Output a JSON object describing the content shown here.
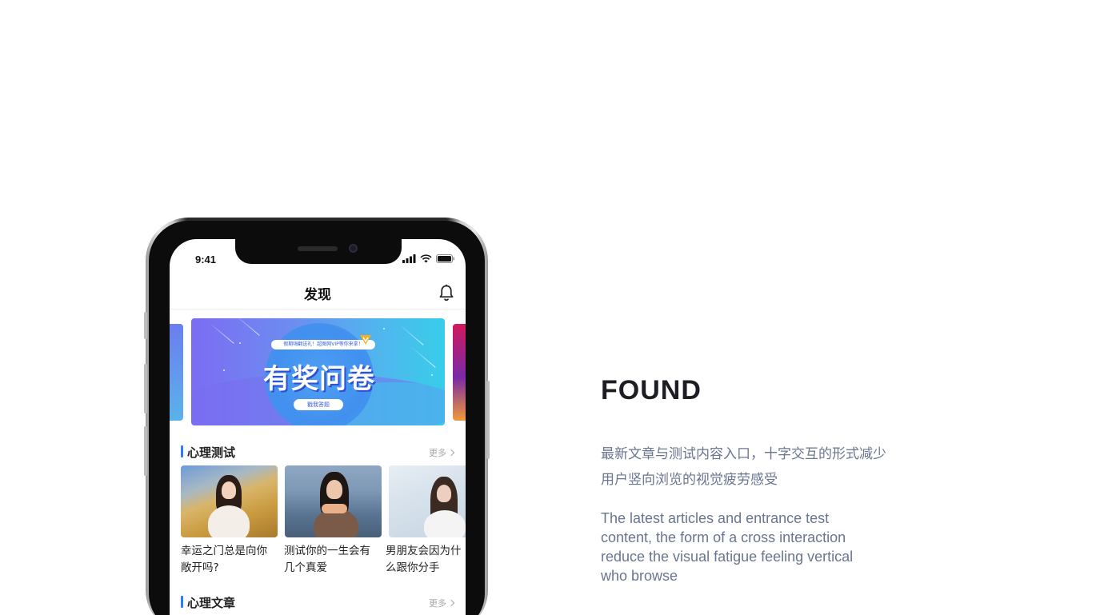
{
  "status_bar": {
    "time": "9:41"
  },
  "nav": {
    "title": "发现"
  },
  "banner": {
    "subline": "假期嗨翻送礼！超图网VIP等你来拿！",
    "title": "有奖问卷",
    "cta": "戳我答题"
  },
  "sections": {
    "tests": {
      "title": "心理测试",
      "more": "更多",
      "cards": [
        {
          "title": "幸运之门总是向你敞开吗?"
        },
        {
          "title": "测试你的一生会有几个真爱"
        },
        {
          "title": "男朋友会因为什么跟你分手"
        }
      ]
    },
    "articles": {
      "title": "心理文章",
      "more": "更多"
    }
  },
  "description": {
    "heading": "FOUND",
    "chinese": "最新文章与测试内容入口，十字交互的形式减少用户竖向浏览的视觉疲劳感受",
    "english": "The latest articles and entrance test content, the form of a cross interaction reduce the visual fatigue feeling vertical who browse"
  },
  "colors": {
    "accent": "#2f7cf6",
    "description_text": "#6a7590",
    "heading_text": "#1d1d24"
  },
  "icons": {
    "nav_right": "bell-icon",
    "status": [
      "signal-icon",
      "wifi-icon",
      "battery-icon"
    ],
    "more": "chevron-right-icon"
  }
}
